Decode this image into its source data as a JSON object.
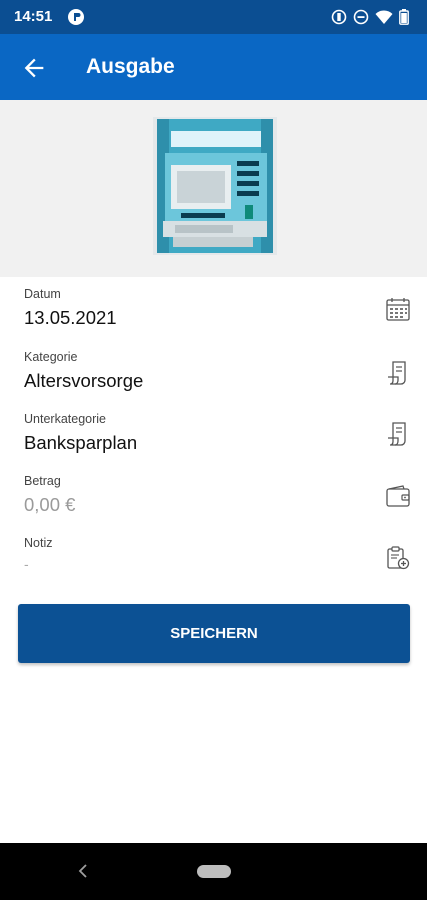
{
  "status_bar": {
    "time": "14:51"
  },
  "app_bar": {
    "title": "Ausgabe"
  },
  "form": {
    "fields": [
      {
        "label": "Datum",
        "value": "13.05.2021",
        "icon": "calendar-icon"
      },
      {
        "label": "Kategorie",
        "value": "Altersvorsorge",
        "icon": "receipt-icon"
      },
      {
        "label": "Unterkategorie",
        "value": "Banksparplan",
        "icon": "receipt-icon"
      },
      {
        "label": "Betrag",
        "value": "0,00 €",
        "icon": "wallet-icon"
      },
      {
        "label": "Notiz",
        "value": "-",
        "icon": "note-add-icon"
      }
    ]
  },
  "save_button": {
    "label": "SPEICHERN"
  },
  "colors": {
    "status_bar": "#0b4e92",
    "app_bar": "#0a67c4",
    "button": "#0c5194"
  }
}
